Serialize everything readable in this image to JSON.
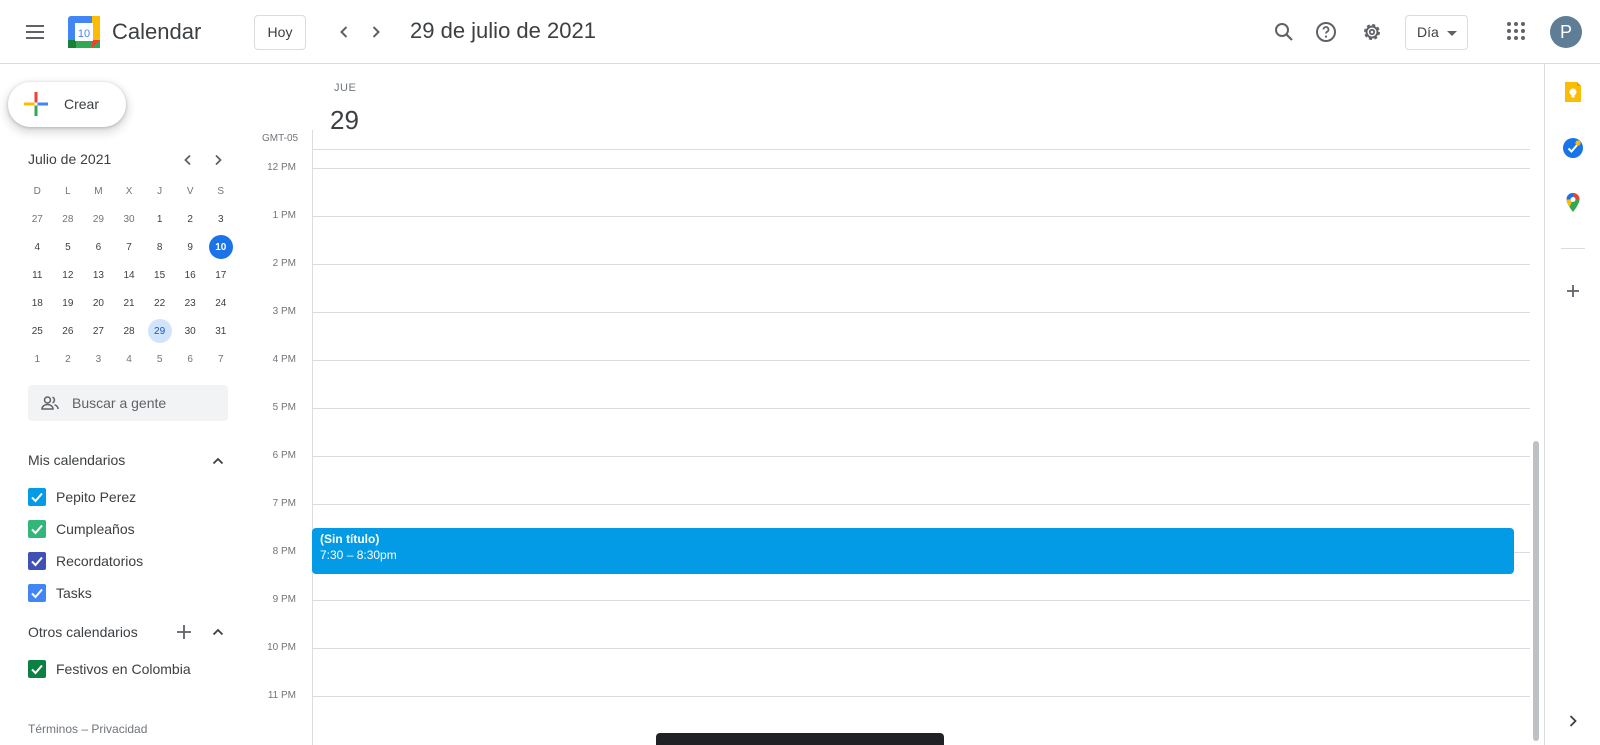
{
  "header": {
    "app_title": "Calendar",
    "logo_day": "10",
    "today_label": "Hoy",
    "date_title": "29 de julio de 2021",
    "view_selected": "Día",
    "avatar_initial": "P"
  },
  "sidebar": {
    "create_label": "Crear",
    "mini_calendar": {
      "title": "Julio de 2021",
      "weekdays": [
        "D",
        "L",
        "M",
        "X",
        "J",
        "V",
        "S"
      ],
      "weeks": [
        [
          "27",
          "28",
          "29",
          "30",
          "1",
          "2",
          "3"
        ],
        [
          "4",
          "5",
          "6",
          "7",
          "8",
          "9",
          "10"
        ],
        [
          "11",
          "12",
          "13",
          "14",
          "15",
          "16",
          "17"
        ],
        [
          "18",
          "19",
          "20",
          "21",
          "22",
          "23",
          "24"
        ],
        [
          "25",
          "26",
          "27",
          "28",
          "29",
          "30",
          "31"
        ],
        [
          "1",
          "2",
          "3",
          "4",
          "5",
          "6",
          "7"
        ]
      ],
      "today": "10",
      "selected": "29"
    },
    "people_search_placeholder": "Buscar a gente",
    "my_calendars_title": "Mis calendarios",
    "my_calendars": [
      {
        "label": "Pepito Perez",
        "color": "#039be5"
      },
      {
        "label": "Cumpleaños",
        "color": "#33b679"
      },
      {
        "label": "Recordatorios",
        "color": "#3f51b5"
      },
      {
        "label": "Tasks",
        "color": "#4285f4"
      }
    ],
    "other_calendars_title": "Otros calendarios",
    "other_calendars": [
      {
        "label": "Festivos en Colombia",
        "color": "#0b8043"
      }
    ],
    "footer_terms": "Términos",
    "footer_sep": " – ",
    "footer_privacy": "Privacidad"
  },
  "main": {
    "day_of_week": "JUE",
    "day_number": "29",
    "timezone": "GMT-05",
    "hours": [
      "12 PM",
      "1 PM",
      "2 PM",
      "3 PM",
      "4 PM",
      "5 PM",
      "6 PM",
      "7 PM",
      "8 PM",
      "9 PM",
      "10 PM",
      "11 PM"
    ],
    "event": {
      "title": "(Sin título)",
      "time": "7:30 – 8:30pm",
      "color": "#039be5"
    }
  },
  "colors": {
    "accent": "#1a73e8",
    "event": "#039be5"
  }
}
